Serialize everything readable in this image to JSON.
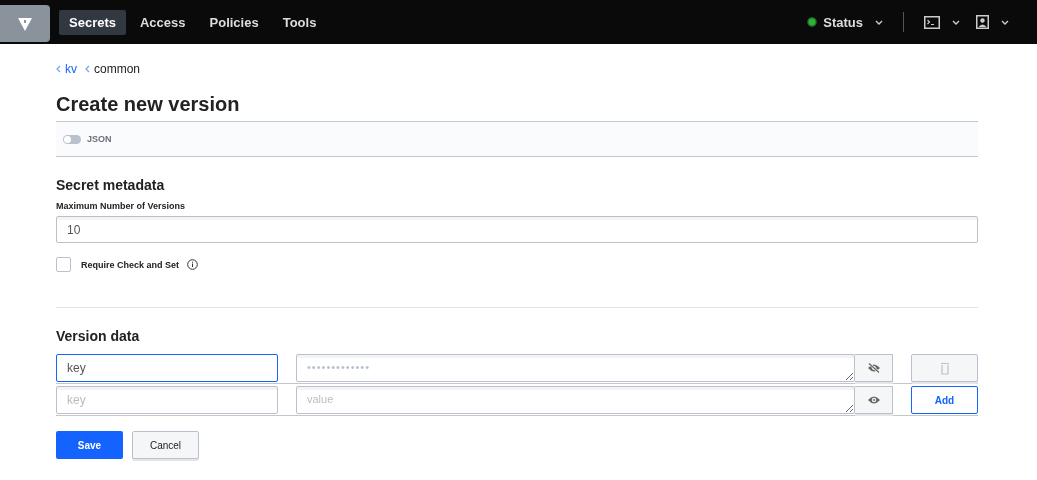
{
  "nav": {
    "items": [
      {
        "label": "Secrets",
        "selected": true
      },
      {
        "label": "Access",
        "selected": false
      },
      {
        "label": "Policies",
        "selected": false
      },
      {
        "label": "Tools",
        "selected": false
      }
    ],
    "status": "Status"
  },
  "breadcrumbs": [
    "kv",
    "common"
  ],
  "title": "Create new version",
  "json_toggle": {
    "label": "JSON",
    "on": false
  },
  "metadata": {
    "heading": "Secret metadata",
    "max_versions_label": "Maximum Number of Versions",
    "max_versions_value": "10",
    "cas_label": "Require Check and Set",
    "cas_checked": false
  },
  "version_data": {
    "heading": "Version data",
    "rows": [
      {
        "key_value": "key",
        "focused": true,
        "value": "•••••••••••••",
        "masked": true,
        "kind": "delete"
      },
      {
        "key_placeholder": "key",
        "focused": false,
        "value_placeholder": "value",
        "masked": false,
        "kind": "add",
        "action_label": "Add"
      }
    ]
  },
  "buttons": {
    "save": "Save",
    "cancel": "Cancel"
  }
}
